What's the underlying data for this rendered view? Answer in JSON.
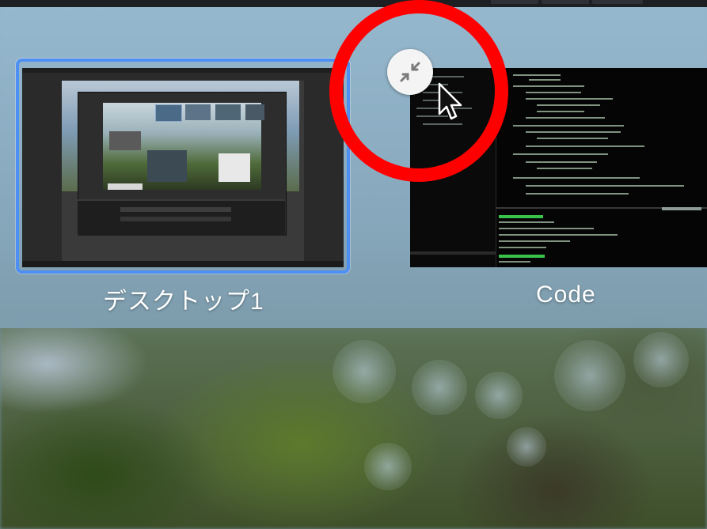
{
  "spaces": [
    {
      "label": "デスクトップ1",
      "selected": true,
      "kind": "desktop"
    },
    {
      "label": "Code",
      "selected": false,
      "kind": "fullscreen-app"
    }
  ],
  "hover_control": {
    "icon": "exit-fullscreen-icon"
  },
  "annotation": {
    "shape": "circle",
    "color": "#ff0000"
  },
  "colors": {
    "selection_border": "#4d8ff3",
    "spaces_bar": "#8fb4c8",
    "annotation": "#ff0000"
  }
}
